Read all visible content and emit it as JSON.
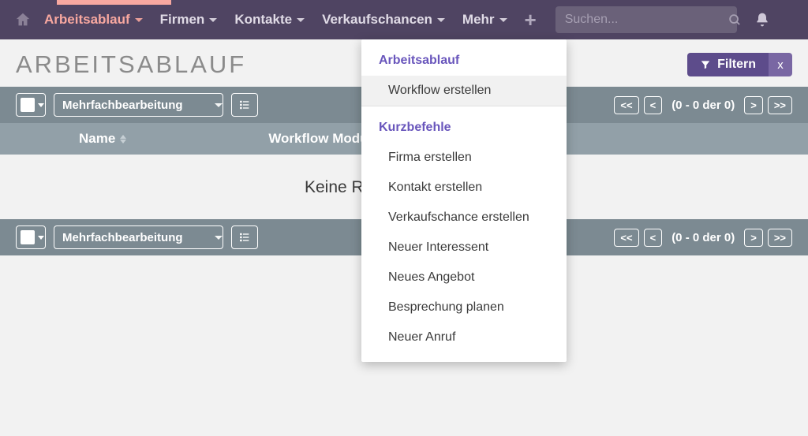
{
  "navbar": {
    "items": [
      {
        "label": "Arbeitsablauf",
        "active": true
      },
      {
        "label": "Firmen"
      },
      {
        "label": "Kontakte"
      },
      {
        "label": "Verkaufschancen"
      },
      {
        "label": "Mehr"
      }
    ],
    "search_placeholder": "Suchen..."
  },
  "page": {
    "title": "ARBEITSABLAUF",
    "filter_label": "Filtern",
    "filter_close": "x"
  },
  "toolbar": {
    "bulk_label": "Mehrfachbearbeitung",
    "pager_text": "(0 - 0 der 0)",
    "pager_first": "<<",
    "pager_prev": "<",
    "pager_next": ">",
    "pager_last": ">>"
  },
  "columns": {
    "col1": "Name",
    "col2": "Workflow Modul"
  },
  "empty_text": "Keine R",
  "dropdown": {
    "title1": "Arbeitsablauf",
    "item1": "Workflow erstellen",
    "title2": "Kurzbefehle",
    "shortcuts": [
      "Firma erstellen",
      "Kontakt erstellen",
      "Verkaufschance erstellen",
      "Neuer Interessent",
      "Neues Angebot",
      "Besprechung planen",
      "Neuer Anruf"
    ]
  }
}
